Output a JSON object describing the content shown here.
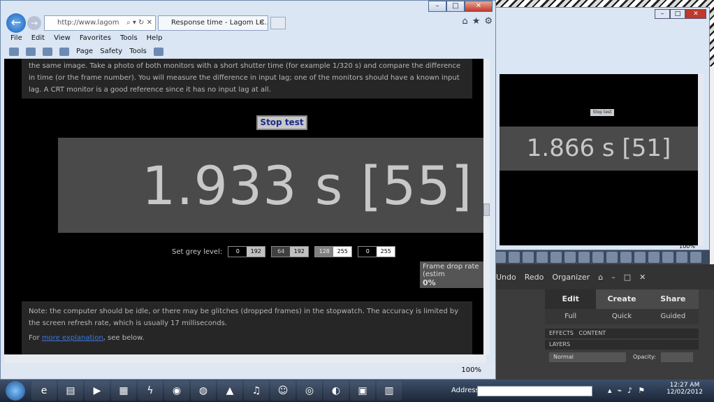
{
  "ie_main": {
    "address_text": "http://www.lagom",
    "tab_title": "Response time - Lagom LC...",
    "menu": [
      "File",
      "Edit",
      "View",
      "Favorites",
      "Tools",
      "Help"
    ],
    "commands": [
      "Page",
      "Safety",
      "Tools"
    ],
    "para1": "the same image. Take a photo of both monitors with a short shutter time (for example 1/320 s) and compare the difference in time (or the frame number). You will measure the difference in input lag; one of the monitors should have a known input lag. A CRT monitor is a good reference since it has no input lag at all.",
    "stop_label": "Stop test",
    "timer": "1.933 s  [55]",
    "grey_label": "Set grey level:",
    "grey_pairs": [
      {
        "a": "0",
        "b": "192"
      },
      {
        "a": "64",
        "b": "192"
      },
      {
        "a": "128",
        "b": "255"
      },
      {
        "a": "0",
        "b": "255"
      }
    ],
    "framedrop_label": "Frame drop rate (estim",
    "framedrop_value": "0%",
    "note": "Note: the computer should be idle, or there may be glitches (dropped frames) in the stopwatch. The accuracy is limited by the screen refresh rate, which is usually 17 milliseconds.",
    "for_text": "For",
    "more_link": "more explanation",
    "after_link": ", see below.",
    "zoom": "100%"
  },
  "ie_second": {
    "timer": "1.866 s  [51]",
    "stop_label": "Stop test",
    "zoom": "100%"
  },
  "photoshop": {
    "undo": "Undo",
    "redo": "Redo",
    "organizer": "Organizer",
    "tabs": [
      "Edit",
      "Create",
      "Share"
    ],
    "subtabs": [
      "Full",
      "Quick",
      "Guided"
    ],
    "effects": "EFFECTS",
    "content": "CONTENT",
    "layers": "LAYERS",
    "blend": "Normal",
    "opacity": "Opacity:"
  },
  "taskbar": {
    "address_label": "Address",
    "time": "12:27 AM",
    "date": "12/02/2012"
  }
}
